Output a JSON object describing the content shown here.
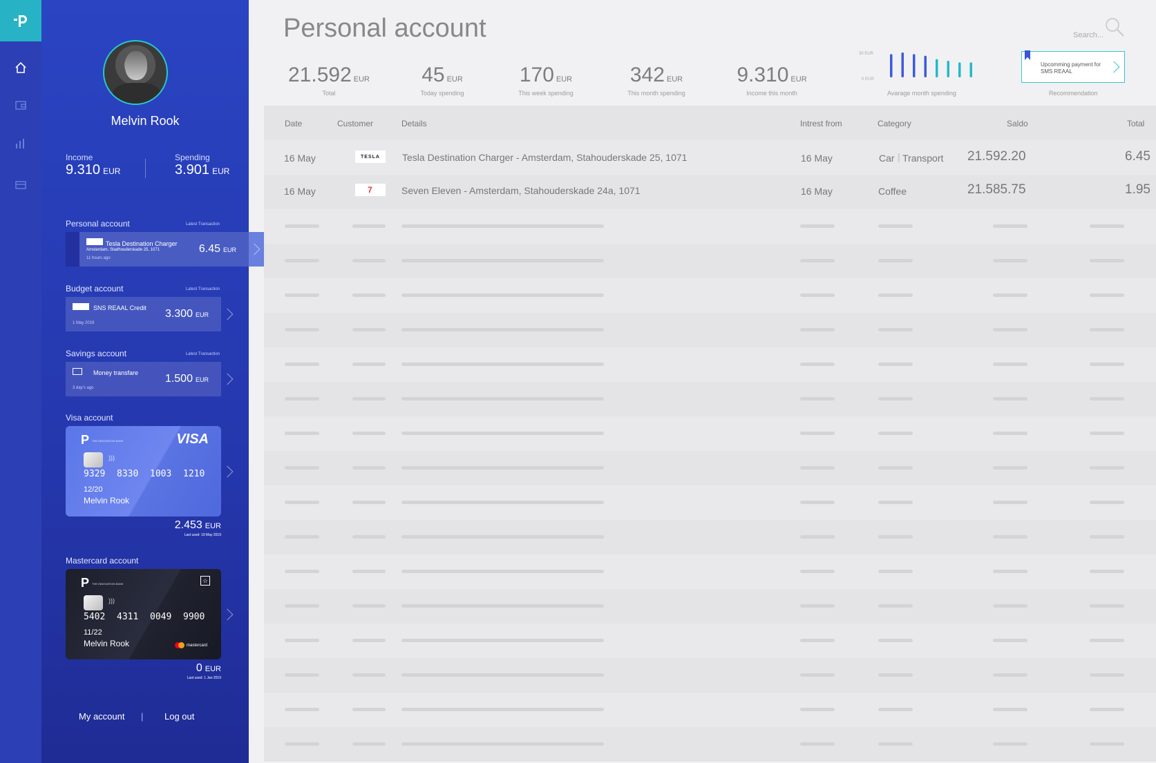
{
  "page": {
    "title": "Personal account",
    "search_placeholder": "Search..."
  },
  "user": {
    "name": "Melvin Rook",
    "income_label": "Income",
    "income_value": "9.310",
    "spending_label": "Spending",
    "spending_value": "3.901",
    "currency": "EUR"
  },
  "accounts": {
    "latest_label": "Latest Transaction",
    "personal": {
      "title": "Personal account",
      "merchant": "Tesla Destination Charger",
      "address": "Amsterdam, Stadhouderskade 25, 1071",
      "time": "11 hours ago",
      "amount": "6.45",
      "currency": "EUR"
    },
    "budget": {
      "title": "Budget account",
      "merchant": "SNS REAAL Credit",
      "time": "1 May 2019",
      "amount": "3.300",
      "currency": "EUR"
    },
    "savings": {
      "title": "Savings account",
      "merchant": "Money transfare",
      "time": "3 day's ago",
      "amount": "1.500",
      "currency": "EUR"
    },
    "visa": {
      "title": "Visa account",
      "bank": "THE INNOVATION BANK",
      "brand": "VISA",
      "numbers": [
        "9329",
        "8330",
        "1003",
        "1210"
      ],
      "expiry": "12/20",
      "holder": "Melvin Rook",
      "amount": "2.453",
      "currency": "EUR",
      "last_used": "Last used: 19 May 2019"
    },
    "mastercard": {
      "title": "Mastercard account",
      "bank": "THE INNOVATION BANK",
      "brand": "mastercard",
      "numbers": [
        "5402",
        "4311",
        "0049",
        "9900"
      ],
      "expiry": "11/22",
      "holder": "Melvin Rook",
      "amount": "0",
      "currency": "EUR",
      "last_used": "Last used: 1 Jan 2019"
    }
  },
  "footer": {
    "my_account": "My account",
    "separator": "|",
    "logout": "Log out"
  },
  "kpis": [
    {
      "value": "21.592",
      "unit": "EUR",
      "label": "Total"
    },
    {
      "value": "45",
      "unit": "EUR",
      "label": "Today spending"
    },
    {
      "value": "170",
      "unit": "EUR",
      "label": "This week spending"
    },
    {
      "value": "342",
      "unit": "EUR",
      "label": "This month spending"
    },
    {
      "value": "9.310",
      "unit": "EUR",
      "label": "Income this month"
    }
  ],
  "chart_data": {
    "type": "bar",
    "title": "Avarage month spending",
    "ymax_label": "30 EUR",
    "ymin_label": "0 EUR",
    "values": [
      28,
      30,
      28,
      26,
      22,
      20,
      18,
      18,
      16
    ],
    "colors": [
      "#3b5bdb",
      "#3b5bdb",
      "#3b5bdb",
      "#3b5bdb",
      "#23b9c9",
      "#23b9c9",
      "#23b9c9",
      "#23b9c9",
      "#23b9c9"
    ]
  },
  "recommendation": {
    "text": "Upcomming payment for SMS REAAL",
    "label": "Recommendation"
  },
  "table": {
    "headers": [
      "Date",
      "Customer",
      "Details",
      "Intrest from",
      "Category",
      "Saldo",
      "Total"
    ],
    "rows": [
      {
        "date": "16 May",
        "customer": "TESLA",
        "details": "Tesla Destination Charger - Amsterdam, Stahouderskade 25, 1071",
        "interest": "16 May",
        "category": "Car",
        "category2": "Transport",
        "saldo": "21.592.20",
        "total": "6.45"
      },
      {
        "date": "16 May",
        "customer": "7",
        "details": "Seven Eleven - Amsterdam, Stahouderskade 24a, 1071",
        "interest": "16 May",
        "category": "Coffee",
        "saldo": "21.585.75",
        "total": "1.95"
      }
    ]
  },
  "colors": {
    "brand": "#2d3fb5",
    "accent": "#27b3c5"
  }
}
